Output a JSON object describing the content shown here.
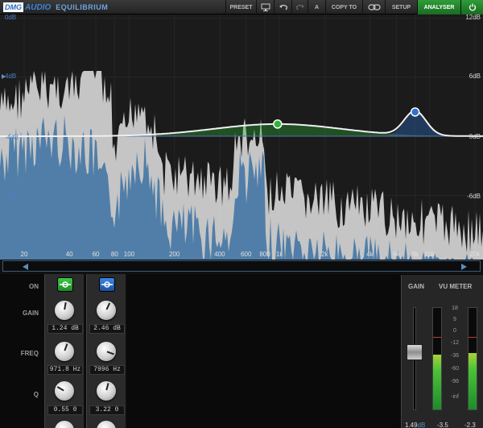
{
  "header": {
    "brand": "DMG",
    "brand_suffix": "AUDIO",
    "product": "EQUILIBRIUM",
    "buttons": [
      "PRESET",
      "COPY TO",
      "SETUP",
      "ANALYSER"
    ],
    "icons": [
      "monitor-icon",
      "undo-icon",
      "redo-icon",
      "a-b-label",
      "link-icon",
      "power-icon"
    ],
    "ab_label": "A"
  },
  "graph": {
    "left_axis": [
      "0dB",
      "4dB",
      "-4dB",
      "-8dB"
    ],
    "right_axis": [
      "12dB",
      "6dB",
      "0dB",
      "-6dB"
    ],
    "freq_labels": [
      "20",
      "40",
      "60",
      "80",
      "100",
      "200",
      "400",
      "600",
      "800",
      "1k",
      "2k",
      "4k",
      "6k",
      "8k",
      "10k",
      "20k"
    ],
    "accent_green": "#2fb43a",
    "accent_blue": "#2f72d0",
    "spectrum_fill": "#4a7aa6",
    "spectrum_peak": "#d8d8d8"
  },
  "bands": {
    "row_labels": {
      "on": "ON",
      "gain": "GAIN",
      "freq": "FREQ",
      "q": "Q"
    },
    "items": [
      {
        "color": "#2fb43a",
        "gain": "1.24 dB",
        "freq": "971.8 Hz",
        "q": "0.55 0"
      },
      {
        "color": "#2f72d0",
        "gain": "2.46 dB",
        "freq": "7996 Hz",
        "q": "3.22 0"
      }
    ]
  },
  "output": {
    "gain_label": "GAIN",
    "vu_label": "VU METER",
    "scale": [
      "18",
      "9",
      "0",
      "-12",
      "-36",
      "-60",
      "-96",
      "-inf"
    ],
    "gain_value": "1.49",
    "gain_unit": "dB",
    "vu_left": "-3.5",
    "vu_right": "-2.3"
  }
}
